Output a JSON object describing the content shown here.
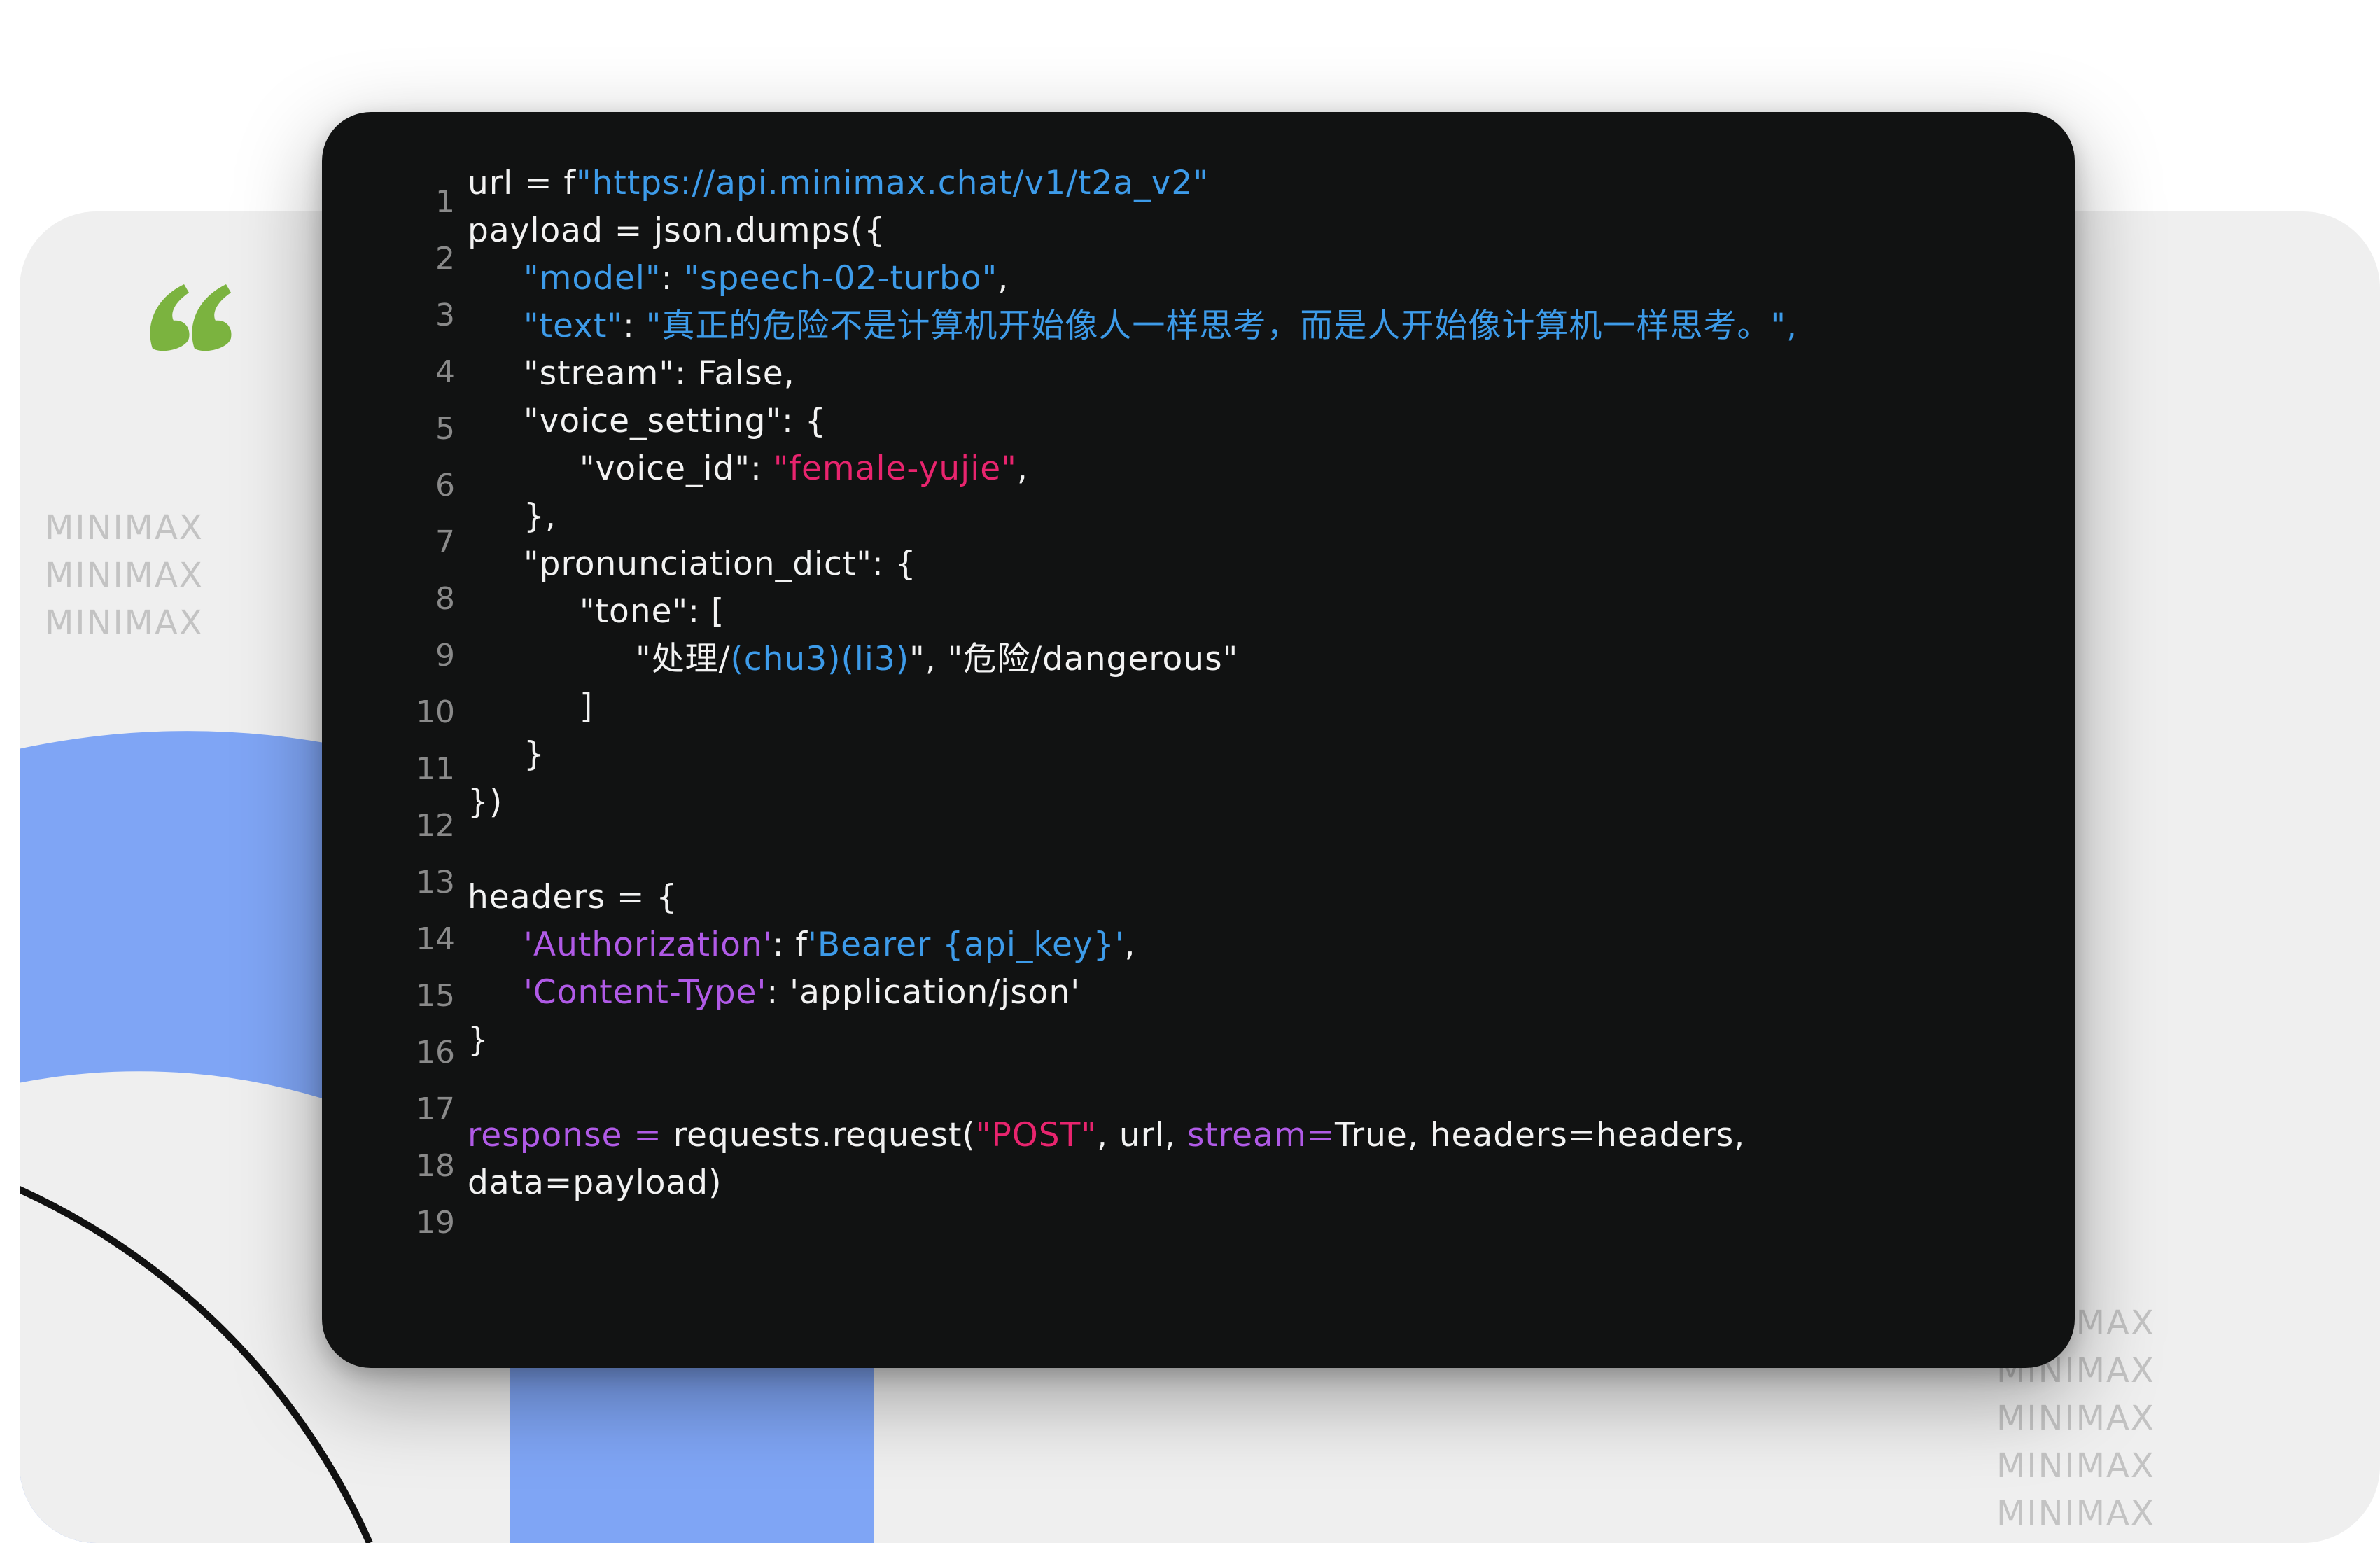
{
  "colors": {
    "background_card": "#efefef",
    "code_background": "#111212",
    "accent_blue_arc": "#7fa5f5",
    "quote_green": "#7bb33f",
    "string_blue": "#3d9be9",
    "string_pink": "#e8246e",
    "keyword_purple": "#b05ae6",
    "code_text": "#f2f2f2",
    "line_number": "#8a8a8a",
    "watermark": "#c3c3c3"
  },
  "quote_icon": "quote-icon",
  "watermark_left": [
    "MINIMAX",
    "MINIMAX",
    "MINIMAX"
  ],
  "watermark_right": [
    "MINIMAX",
    "MINIMAX",
    "MINIMAX",
    "MINIMAX",
    "MINIMAX"
  ],
  "code": {
    "line_numbers": [
      "1",
      "2",
      "3",
      "4",
      "5",
      "6",
      "7",
      "8",
      "9",
      "10",
      "11",
      "12",
      "13",
      "14",
      "15",
      "16",
      "17",
      "18",
      "19"
    ],
    "l1_a": "url = f",
    "l1_b": "\"https://api.minimax.chat/v1/t2a_v2\"",
    "l2": "payload = json.dumps({",
    "l3_a": "\"model\"",
    "l3_b": ": ",
    "l3_c": "\"speech-02-turbo\"",
    "l3_d": ",",
    "l4_a": "\"text\"",
    "l4_b": ": ",
    "l4_c": "\"真正的危险不是计算机开始像人一样思考，而是人开始像计算机一样思考。\",",
    "l5": "\"stream\": False,",
    "l6": "\"voice_setting\": {",
    "l7_a": "\"voice_id\": ",
    "l7_b": "\"female-yujie\"",
    "l7_c": ",",
    "l8": "},",
    "l9": "\"pronunciation_dict\": {",
    "l10": "\"tone\": [",
    "l11_a": "\"处理/",
    "l11_b": "(chu3)(li3)",
    "l11_c": "\", \"危险/dangerous\"",
    "l12": "]",
    "l13": "}",
    "l14": "})",
    "l16": "headers = {",
    "l17_a": "'Authorization'",
    "l17_b": ": f",
    "l17_c": "'Bearer {api_key}'",
    "l17_d": ",",
    "l18_a": "'Content-Type'",
    "l18_b": ": 'application/json'",
    "l19": "}",
    "l21_a": "response =",
    "l21_b": " requests.request(",
    "l21_c": "\"POST\"",
    "l21_d": ", url, ",
    "l21_e": "stream=",
    "l21_f": "True, headers=headers,",
    "l22": "data=payload)"
  }
}
